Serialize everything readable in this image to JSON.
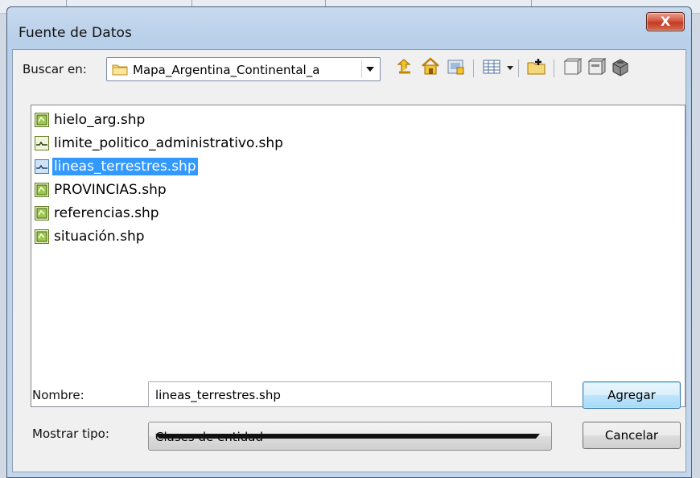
{
  "window": {
    "title": "Fuente de Datos",
    "close_glyph": "X"
  },
  "lookin": {
    "label": "Buscar en:",
    "value": "Mapa_Argentina_Continental_a",
    "icon": "folder-icon"
  },
  "toolbar": {
    "icons": [
      "up-level-icon",
      "home-icon",
      "connect-folder-icon",
      "list-view-icon",
      "new-folder-icon",
      "catalog-icon",
      "database-icon",
      "toolbox-icon"
    ]
  },
  "files": [
    {
      "name": "hielo_arg.shp",
      "icon": "polygon-shapefile-icon",
      "selected": false
    },
    {
      "name": "limite_politico_administrativo.shp",
      "icon": "line-shapefile-icon",
      "selected": false
    },
    {
      "name": "lineas_terrestres.shp",
      "icon": "line-shapefile-icon",
      "selected": true
    },
    {
      "name": "PROVINCIAS.shp",
      "icon": "polygon-shapefile-icon",
      "selected": false
    },
    {
      "name": "referencias.shp",
      "icon": "polygon-shapefile-icon",
      "selected": false
    },
    {
      "name": "situación.shp",
      "icon": "polygon-shapefile-icon",
      "selected": false
    }
  ],
  "form": {
    "name_label": "Nombre:",
    "name_value": "lineas_terrestres.shp",
    "type_label": "Mostrar tipo:",
    "type_value": "Clases de entidad"
  },
  "buttons": {
    "add": "Agregar",
    "cancel": "Cancelar"
  },
  "colors": {
    "selection": "#3399ff",
    "close_button": "#c94a33",
    "title_bar": "#b9d0ea"
  }
}
